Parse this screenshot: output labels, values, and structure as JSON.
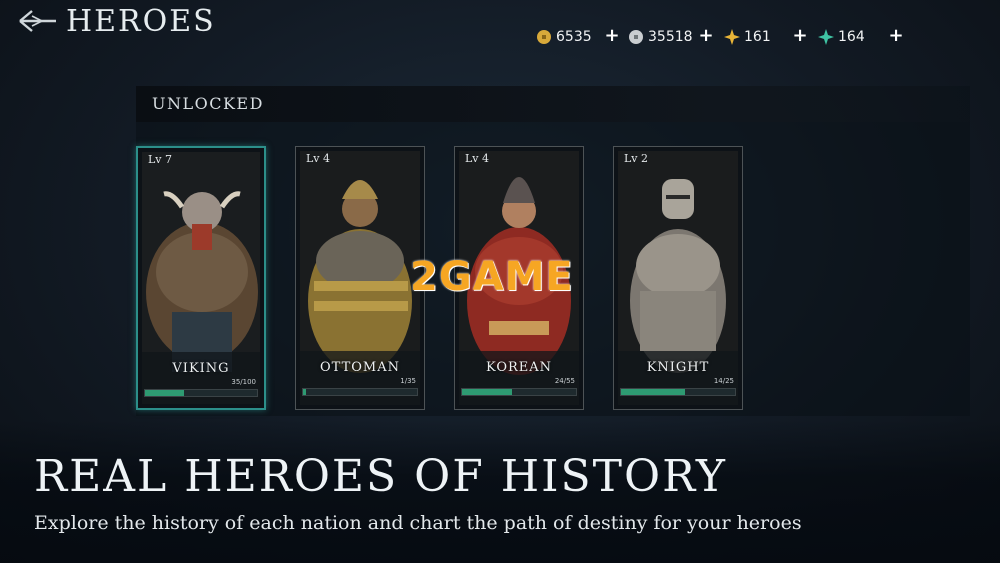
{
  "header": {
    "title": "HEROES"
  },
  "resources": [
    {
      "name": "gold",
      "icon": "gold-coin-icon",
      "value": "6535",
      "color": "#d8a93a"
    },
    {
      "name": "silver",
      "icon": "silver-coin-icon",
      "value": "35518",
      "color": "#c9cdd0"
    },
    {
      "name": "star-shard",
      "icon": "star-shard-icon",
      "value": "161",
      "color": "#e8b437"
    },
    {
      "name": "jade-star",
      "icon": "jade-star-icon",
      "value": "164",
      "color": "#3fc3a3"
    }
  ],
  "panel": {
    "title": "UNLOCKED"
  },
  "heroes": [
    {
      "level": "Lv 7",
      "name": "VIKING",
      "progress_text": "35/100",
      "progress": 0.35,
      "selected": true
    },
    {
      "level": "Lv 4",
      "name": "OTTOMAN",
      "progress_text": "1/35",
      "progress": 0.03,
      "selected": false
    },
    {
      "level": "Lv 4",
      "name": "KOREAN",
      "progress_text": "24/55",
      "progress": 0.44,
      "selected": false
    },
    {
      "level": "Lv 2",
      "name": "KNIGHT",
      "progress_text": "14/25",
      "progress": 0.56,
      "selected": false
    }
  ],
  "watermark": "2GAME",
  "promo": {
    "headline": "REAL HEROES OF HISTORY",
    "subline": "Explore the history of each nation and chart the path of destiny for your heroes"
  }
}
